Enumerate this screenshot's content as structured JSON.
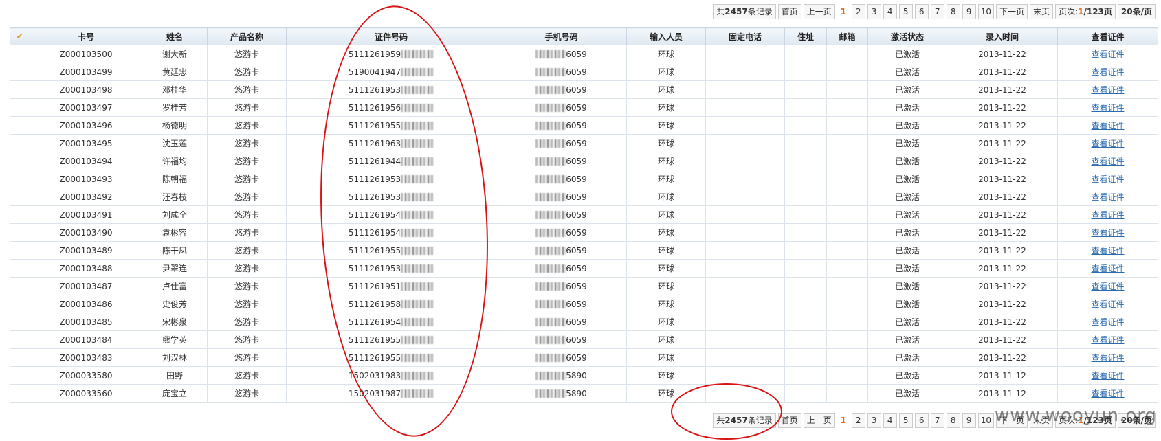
{
  "pager": {
    "total_prefix": "共",
    "total_count": "2457",
    "total_suffix": "条记录",
    "first": "首页",
    "prev": "上一页",
    "pages": [
      "1",
      "2",
      "3",
      "4",
      "5",
      "6",
      "7",
      "8",
      "9",
      "10"
    ],
    "current": "1",
    "next": "下一页",
    "last": "末页",
    "page_prefix": "页次:",
    "page_current": "1",
    "page_total": "/123页",
    "per_page": "20条/页"
  },
  "table": {
    "headers": [
      "卡号",
      "姓名",
      "产品名称",
      "证件号码",
      "手机号码",
      "输入人员",
      "固定电话",
      "住址",
      "邮箱",
      "激活状态",
      "录入时间",
      "查看证件"
    ],
    "rows": [
      {
        "card": "Z000103500",
        "name": "谢大新",
        "product": "悠游卡",
        "id_prefix": "5111261959",
        "phone_suffix": "6059",
        "operator": "环球",
        "status": "已激活",
        "date": "2013-11-22",
        "view": "查看证件"
      },
      {
        "card": "Z000103499",
        "name": "黄廷忠",
        "product": "悠游卡",
        "id_prefix": "5190041947",
        "phone_suffix": "6059",
        "operator": "环球",
        "status": "已激活",
        "date": "2013-11-22",
        "view": "查看证件"
      },
      {
        "card": "Z000103498",
        "name": "邓桂华",
        "product": "悠游卡",
        "id_prefix": "5111261953",
        "phone_suffix": "6059",
        "operator": "环球",
        "status": "已激活",
        "date": "2013-11-22",
        "view": "查看证件"
      },
      {
        "card": "Z000103497",
        "name": "罗桂芳",
        "product": "悠游卡",
        "id_prefix": "5111261956",
        "phone_suffix": "6059",
        "operator": "环球",
        "status": "已激活",
        "date": "2013-11-22",
        "view": "查看证件"
      },
      {
        "card": "Z000103496",
        "name": "杨德明",
        "product": "悠游卡",
        "id_prefix": "5111261955",
        "phone_suffix": "6059",
        "operator": "环球",
        "status": "已激活",
        "date": "2013-11-22",
        "view": "查看证件"
      },
      {
        "card": "Z000103495",
        "name": "沈玉莲",
        "product": "悠游卡",
        "id_prefix": "5111261963",
        "phone_suffix": "6059",
        "operator": "环球",
        "status": "已激活",
        "date": "2013-11-22",
        "view": "查看证件"
      },
      {
        "card": "Z000103494",
        "name": "许福均",
        "product": "悠游卡",
        "id_prefix": "5111261944",
        "phone_suffix": "6059",
        "operator": "环球",
        "status": "已激活",
        "date": "2013-11-22",
        "view": "查看证件"
      },
      {
        "card": "Z000103493",
        "name": "陈朝福",
        "product": "悠游卡",
        "id_prefix": "5111261953",
        "phone_suffix": "6059",
        "operator": "环球",
        "status": "已激活",
        "date": "2013-11-22",
        "view": "查看证件"
      },
      {
        "card": "Z000103492",
        "name": "汪春枝",
        "product": "悠游卡",
        "id_prefix": "5111261953",
        "phone_suffix": "6059",
        "operator": "环球",
        "status": "已激活",
        "date": "2013-11-22",
        "view": "查看证件"
      },
      {
        "card": "Z000103491",
        "name": "刘成全",
        "product": "悠游卡",
        "id_prefix": "5111261954",
        "phone_suffix": "6059",
        "operator": "环球",
        "status": "已激活",
        "date": "2013-11-22",
        "view": "查看证件"
      },
      {
        "card": "Z000103490",
        "name": "袁彬容",
        "product": "悠游卡",
        "id_prefix": "5111261954",
        "phone_suffix": "6059",
        "operator": "环球",
        "status": "已激活",
        "date": "2013-11-22",
        "view": "查看证件"
      },
      {
        "card": "Z000103489",
        "name": "陈干凤",
        "product": "悠游卡",
        "id_prefix": "5111261955",
        "phone_suffix": "6059",
        "operator": "环球",
        "status": "已激活",
        "date": "2013-11-22",
        "view": "查看证件"
      },
      {
        "card": "Z000103488",
        "name": "尹翠连",
        "product": "悠游卡",
        "id_prefix": "5111261953",
        "phone_suffix": "6059",
        "operator": "环球",
        "status": "已激活",
        "date": "2013-11-22",
        "view": "查看证件"
      },
      {
        "card": "Z000103487",
        "name": "卢仕富",
        "product": "悠游卡",
        "id_prefix": "5111261951",
        "phone_suffix": "6059",
        "operator": "环球",
        "status": "已激活",
        "date": "2013-11-22",
        "view": "查看证件"
      },
      {
        "card": "Z000103486",
        "name": "史俊芳",
        "product": "悠游卡",
        "id_prefix": "5111261958",
        "phone_suffix": "6059",
        "operator": "环球",
        "status": "已激活",
        "date": "2013-11-22",
        "view": "查看证件"
      },
      {
        "card": "Z000103485",
        "name": "宋彬泉",
        "product": "悠游卡",
        "id_prefix": "5111261954",
        "phone_suffix": "6059",
        "operator": "环球",
        "status": "已激活",
        "date": "2013-11-22",
        "view": "查看证件"
      },
      {
        "card": "Z000103484",
        "name": "熊学英",
        "product": "悠游卡",
        "id_prefix": "5111261955",
        "phone_suffix": "6059",
        "operator": "环球",
        "status": "已激活",
        "date": "2013-11-22",
        "view": "查看证件"
      },
      {
        "card": "Z000103483",
        "name": "刘汉林",
        "product": "悠游卡",
        "id_prefix": "5111261955",
        "phone_suffix": "6059",
        "operator": "环球",
        "status": "已激活",
        "date": "2013-11-22",
        "view": "查看证件"
      },
      {
        "card": "Z000033580",
        "name": "田野",
        "product": "悠游卡",
        "id_prefix": "1502031983",
        "phone_suffix": "5890",
        "operator": "环球",
        "status": "已激活",
        "date": "2013-11-12",
        "view": "查看证件"
      },
      {
        "card": "Z000033560",
        "name": "庞宝立",
        "product": "悠游卡",
        "id_prefix": "1502031987",
        "phone_suffix": "5890",
        "operator": "环球",
        "status": "已激活",
        "date": "2013-11-12",
        "view": "查看证件"
      }
    ]
  },
  "watermark": "www.wooyun.org",
  "colors": {
    "accent": "#e06d15",
    "link": "#2a6bb1",
    "annotation": "#d81414"
  }
}
